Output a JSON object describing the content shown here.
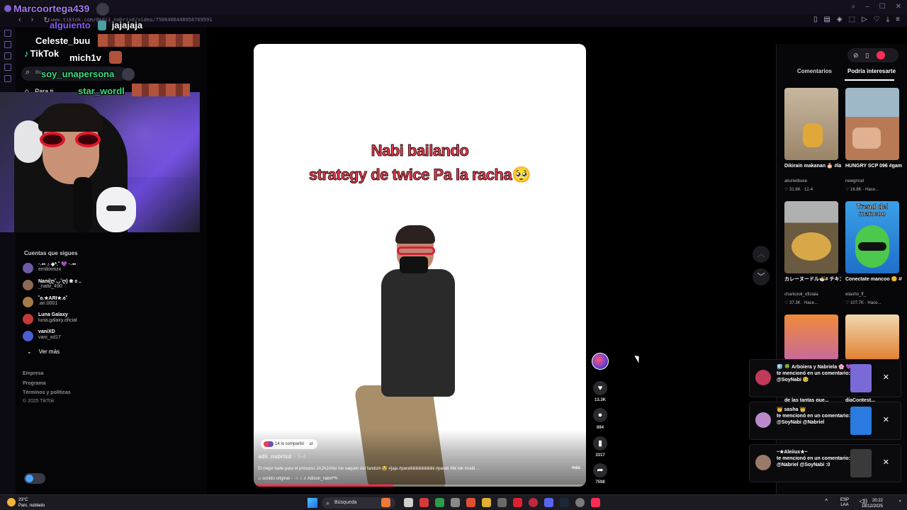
{
  "browser": {
    "url": "www.tiktok.com/@adii_nabrixd/video/7506406448956769591",
    "nav": [
      "‹",
      "›",
      "↻"
    ],
    "toolbar_icons": [
      "bookmark-icon",
      "tab-icon",
      "extensions-icon",
      "cast-icon",
      "play-icon",
      "heart-icon",
      "download-icon",
      "menu-icon"
    ]
  },
  "tiktok_nav": {
    "logo": "TikTok",
    "search_placeholder": "Bu",
    "for_you": "Para ti",
    "following_title": "Cuentas que sigues",
    "following": [
      {
        "name": "·˖➻ ♪ ◈*.˚ 💜 ·˖➻",
        "handle": "emiliixmzx",
        "color": "#6e5aa8"
      },
      {
        "name": "Nani(ღ˘◡˘ღ) ❀ ი ..",
        "handle": "_natiii_490",
        "color": "#8a6a52"
      },
      {
        "name": "˚ʚ.★ARI★.ɞ˚",
        "handle": ".ari.0001",
        "color": "#a57c48"
      },
      {
        "name": "Luna Galaxy",
        "handle": "luna.galaxy.oficial",
        "color": "#c23a3a"
      },
      {
        "name": "vaniXD",
        "handle": "vani_xd17",
        "color": "#4a5fd1"
      }
    ],
    "see_more": "Ver más",
    "footer": [
      "Empresa",
      "Programa",
      "Términos y políticas",
      "© 2025 TikTok"
    ]
  },
  "chat": [
    {
      "user": "Marcoortega439",
      "color": "#a77bf3",
      "message": ""
    },
    {
      "user": "alguiento",
      "color": "#8a5cf6",
      "message": "jajajaja"
    },
    {
      "user": "Celeste_buu",
      "color": "#ffffff",
      "message": ""
    },
    {
      "user": "mich1v",
      "color": "#ffffff",
      "message": ""
    },
    {
      "user": "soy_unapersona",
      "color": "#3ddc84",
      "message": ""
    },
    {
      "user": "star_wordl",
      "color": "#3ddc84",
      "message": ""
    }
  ],
  "video": {
    "caption_line1": "Nabi bailando",
    "caption_line2": "strategy de twice Pa la racha🥺",
    "shared": "14 lo compartió",
    "author": "adii_nabrixd",
    "age": "· 5-4",
    "description": "El mejor baile para el princeso JAJAJANo me saquen del fandom 😭 #jaja #paratiiiiiiiiiiiiiiiiiiiiiiiii #parati #tik tok #nabi ...",
    "more": "más",
    "sound": "♫ sonido original - ·☆ ♪ ♬Adison_nabri*ᵈᵍ·",
    "progress": 0.42
  },
  "actions": {
    "likes": "13.3K",
    "comments": "894",
    "saves": "3317",
    "shares": "7598"
  },
  "right_panel": {
    "tabs": [
      "Comentarios",
      "Podría interesarte"
    ],
    "active_tab": 1,
    "thumbs": [
      {
        "title": "Dikirain makanan 🎂 #larvaseason...",
        "author": "akunwibuee",
        "stats": "♡ 31.6K · 12-4",
        "label": "",
        "bg": "#b9a48a"
      },
      {
        "title": "HUNGRY SCP 096 #games #gmod...",
        "author": "newgmod",
        "stats": "♡ 16.8K · Hace...",
        "label": "",
        "bg": "#b87a55"
      },
      {
        "title": "カレーヌードル🍜# チキンラーメン #...",
        "author": "charlcook_oficiala",
        "stats": "♡ 37.3K · Hace...",
        "label": "",
        "bg": "#8a7a5a"
      },
      {
        "title": "Conectate mancoo 😊 #fyp #Garen...",
        "author": "eliasho_ff_",
        "stats": "♡ 107.7K · Hace...",
        "label": "Trend del mancoo",
        "bg": "#2c8ad8"
      },
      {
        "title": "",
        "author": "",
        "stats": "",
        "label": "",
        "bg": "#d07a3a"
      },
      {
        "title": "",
        "author": "",
        "stats": "",
        "label": "",
        "bg": "#e0a040"
      }
    ]
  },
  "notifications": [
    {
      "text_top": "🧊 🍀 Arboiera y Nabriela 🌸 💜",
      "text": "te mencionó en un comentario: @SoyNabi 🥺",
      "avcolor": "#c23a5a",
      "piccolor": "#7a6ad8"
    },
    {
      "text_top": "👑 sasha 👑",
      "text": "te mencionó en un comentario: @SoyNabi @Nabriel",
      "avcolor": "#b98acb",
      "piccolor": "#2a7ae0"
    },
    {
      "text_top": "~★Aleiiux★~",
      "text": "te mencionó en un comentario: @Nabriel @SoyNabi :0",
      "avcolor": "#9a7a6a",
      "piccolor": "#3a3a3a"
    }
  ],
  "peek_titles": [
    "de las tantas que...",
    "diaContest..."
  ],
  "taskbar": {
    "temp": "23°C",
    "weather": "Parc. nublado",
    "search": "Búsqueda",
    "lang": "ESP\nLAA",
    "time": "20:22",
    "date": "18/12/2025"
  }
}
